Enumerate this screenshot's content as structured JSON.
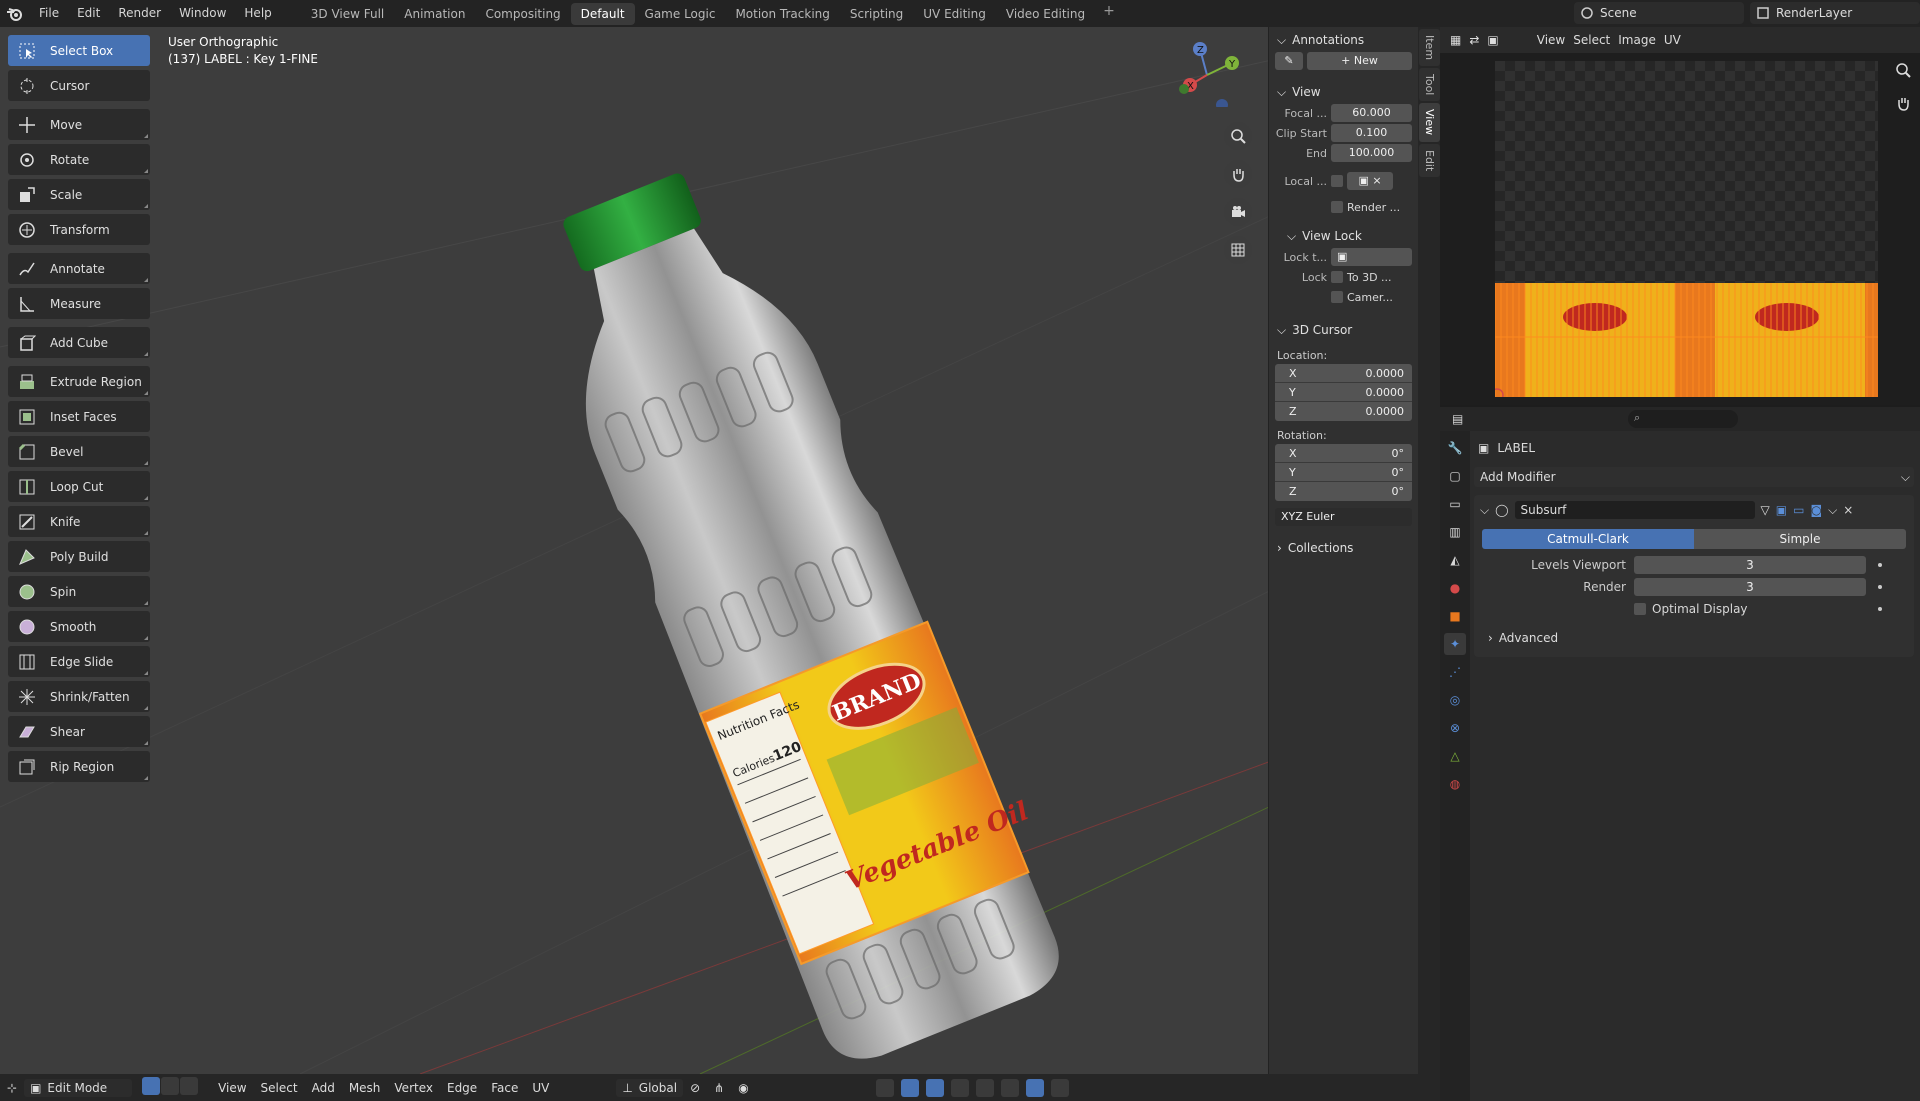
{
  "topbar": {
    "menus": [
      "File",
      "Edit",
      "Render",
      "Window",
      "Help"
    ],
    "workspaces": [
      "3D View Full",
      "Animation",
      "Compositing",
      "Default",
      "Game Logic",
      "Motion Tracking",
      "Scripting",
      "UV Editing",
      "Video Editing"
    ],
    "active_workspace": "Default",
    "scene": "Scene",
    "render_layer": "RenderLayer"
  },
  "viewport": {
    "view_name": "User Orthographic",
    "object_info": "(137) LABEL : Key 1-FINE"
  },
  "tools": [
    {
      "label": "Select Box",
      "icon": "select-box-icon",
      "active": true
    },
    {
      "label": "Cursor",
      "icon": "cursor-icon"
    },
    {
      "label": "Move",
      "icon": "move-icon"
    },
    {
      "label": "Rotate",
      "icon": "rotate-icon"
    },
    {
      "label": "Scale",
      "icon": "scale-icon"
    },
    {
      "label": "Transform",
      "icon": "transform-icon"
    },
    {
      "label": "Annotate",
      "icon": "annotate-icon"
    },
    {
      "label": "Measure",
      "icon": "measure-icon"
    },
    {
      "label": "Add Cube",
      "icon": "add-cube-icon"
    },
    {
      "label": "Extrude Region",
      "icon": "extrude-icon"
    },
    {
      "label": "Inset Faces",
      "icon": "inset-icon"
    },
    {
      "label": "Bevel",
      "icon": "bevel-icon"
    },
    {
      "label": "Loop Cut",
      "icon": "loop-cut-icon"
    },
    {
      "label": "Knife",
      "icon": "knife-icon"
    },
    {
      "label": "Poly Build",
      "icon": "poly-build-icon"
    },
    {
      "label": "Spin",
      "icon": "spin-icon"
    },
    {
      "label": "Smooth",
      "icon": "smooth-icon"
    },
    {
      "label": "Edge Slide",
      "icon": "edge-slide-icon"
    },
    {
      "label": "Shrink/Fatten",
      "icon": "shrink-fatten-icon"
    },
    {
      "label": "Shear",
      "icon": "shear-icon"
    },
    {
      "label": "Rip Region",
      "icon": "rip-icon"
    }
  ],
  "npanel": {
    "annotations": {
      "title": "Annotations",
      "new_label": "New"
    },
    "view": {
      "title": "View",
      "focal_label": "Focal ...",
      "focal": "60.000",
      "clip_start_label": "Clip Start",
      "clip_start": "0.100",
      "end_label": "End",
      "end": "100.000",
      "local_label": "Local ...",
      "render_label": "Render ...",
      "view_lock": "View Lock",
      "lock_to_label": "Lock t...",
      "lock_label": "Lock",
      "to3d_label": "To 3D ...",
      "camera_label": "Camer..."
    },
    "cursor": {
      "title": "3D Cursor",
      "location_label": "Location:",
      "location": [
        {
          "axis": "X",
          "value": "0.0000"
        },
        {
          "axis": "Y",
          "value": "0.0000"
        },
        {
          "axis": "Z",
          "value": "0.0000"
        }
      ],
      "rotation_label": "Rotation:",
      "rotation": [
        {
          "axis": "X",
          "value": "0°"
        },
        {
          "axis": "Y",
          "value": "0°"
        },
        {
          "axis": "Z",
          "value": "0°"
        }
      ],
      "rotation_mode": "XYZ Euler"
    },
    "collections": "Collections",
    "tabs": [
      "Item",
      "Tool",
      "View",
      "Edit"
    ],
    "active_tab": "View"
  },
  "bottombar": {
    "mode": "Edit Mode",
    "menus": [
      "View",
      "Select",
      "Add",
      "Mesh",
      "Vertex",
      "Edge",
      "Face",
      "UV"
    ],
    "orientation": "Global"
  },
  "image_editor": {
    "menus": [
      "View",
      "Select",
      "Image",
      "UV"
    ]
  },
  "properties": {
    "object_name": "LABEL",
    "add_modifier": "Add Modifier",
    "modifier_name": "Subsurf",
    "mode_options": [
      "Catmull-Clark",
      "Simple"
    ],
    "active_mode": "Catmull-Clark",
    "levels_viewport_label": "Levels Viewport",
    "levels_viewport": "3",
    "render_label": "Render",
    "render": "3",
    "optimal_display": "Optimal Display",
    "advanced": "Advanced"
  },
  "label_art": {
    "brand": "BRAND",
    "product": "Vegetable Oil",
    "nutrition_title": "Nutrition Facts",
    "calories_label": "Calories",
    "calories": "120"
  },
  "colors": {
    "accent": "#4772b3",
    "cap": "#1f8a2e",
    "label_orange": "#e8781e",
    "label_yellow": "#f2c919",
    "brand_red": "#c0281f"
  }
}
